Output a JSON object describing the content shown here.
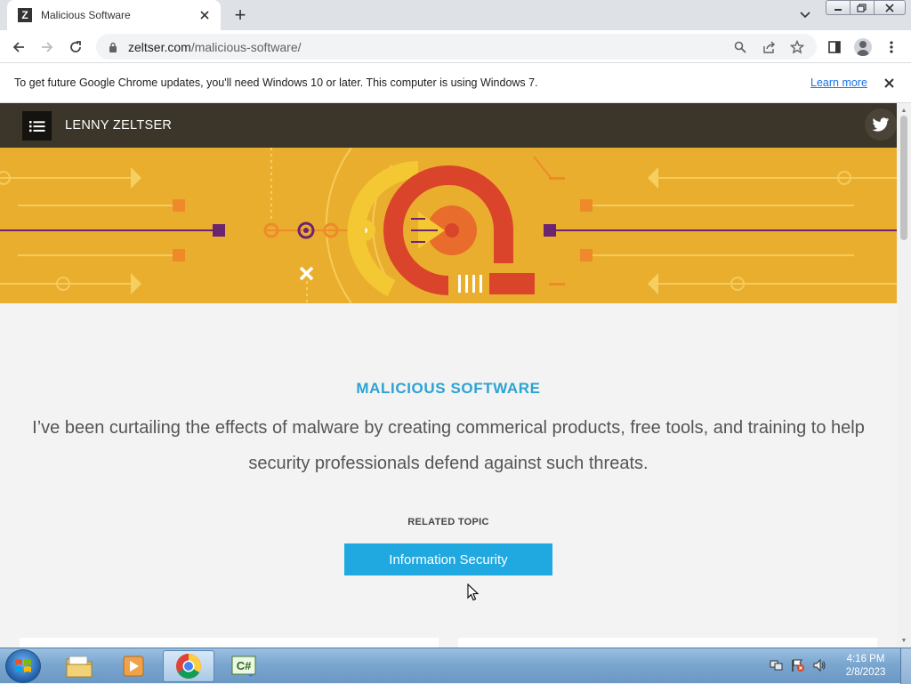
{
  "browser": {
    "tab_title": "Malicious Software",
    "tab_favicon_letter": "Z",
    "new_tab_symbol": "+",
    "url_domain": "zeltser.com",
    "url_path": "/malicious-software/",
    "infobar_text": "To get future Google Chrome updates, you'll need Windows 10 or later. This computer is using Windows 7.",
    "infobar_link": "Learn more"
  },
  "site": {
    "brand": "LENNY ZELTSER",
    "page_title": "MALICIOUS SOFTWARE",
    "lead_text": "I’ve been curtailing the effects of malware by creating commerical products, free tools, and training to help security professionals defend against such threats.",
    "related_label": "RELATED TOPIC",
    "related_button": "Information Security"
  },
  "taskbar": {
    "time": "4:16 PM",
    "date": "2/8/2023",
    "csharp_label": "C#"
  },
  "colors": {
    "header_bg": "#3b352a",
    "hero_bg": "#eaae2e",
    "accent_blue": "#2ba3d3",
    "button_blue": "#20a8e0",
    "hero_red": "#d9442a",
    "hero_purple": "#6b2470"
  },
  "icons": {
    "menu": "hamburger-menu-icon",
    "twitter": "twitter-icon",
    "lock": "lock-icon",
    "search": "search-icon",
    "share": "share-icon",
    "star": "star-icon",
    "sidepanel": "side-panel-icon",
    "profile": "profile-icon",
    "kebab": "more-options-icon"
  }
}
